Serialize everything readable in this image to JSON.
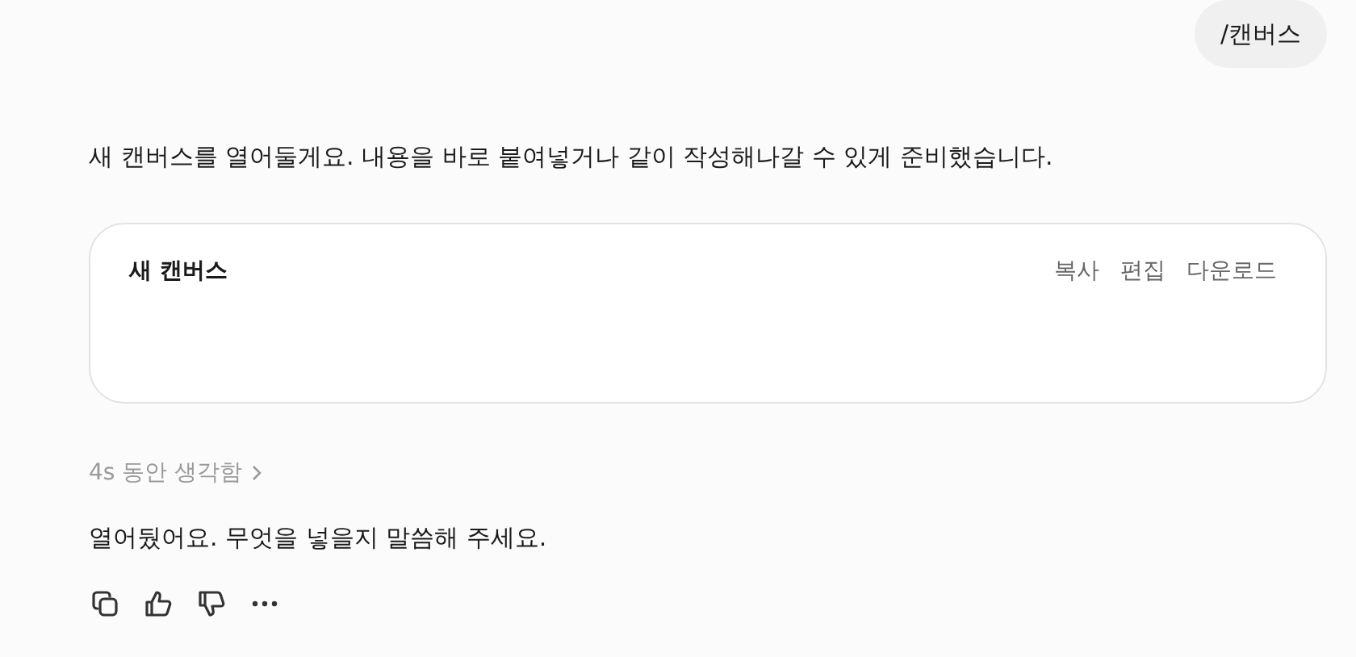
{
  "user_message": {
    "text": "/캔버스"
  },
  "assistant_intro": {
    "text": "새 캔버스를 열어둘게요. 내용을 바로 붙여넣거나 같이 작성해나갈 수 있게 준비했습니다."
  },
  "canvas_card": {
    "title": "새 캔버스",
    "actions": [
      "복사",
      "편집",
      "다운로드"
    ]
  },
  "thinking": {
    "label": "4s 동안 생각함",
    "expanded": false
  },
  "assistant_reply": {
    "text": "열어뒀어요. 무엇을 넣을지 말씀해 주세요."
  },
  "message_actions": [
    {
      "kind": "copy"
    },
    {
      "kind": "thumbs-up"
    },
    {
      "kind": "thumbs-down"
    },
    {
      "kind": "more"
    }
  ]
}
